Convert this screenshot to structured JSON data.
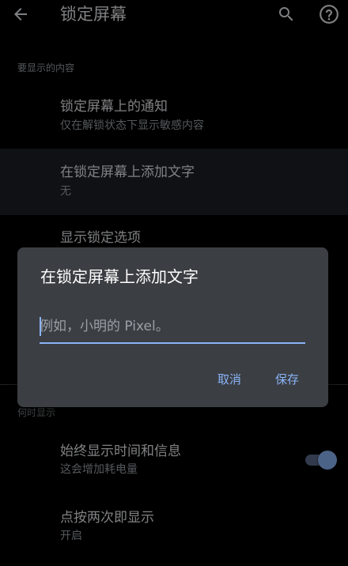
{
  "header": {
    "title": "锁定屏幕",
    "back_icon": "arrow-back-icon",
    "search_icon": "search-icon",
    "help_icon": "help-icon"
  },
  "sections": {
    "display_content": "要显示的内容",
    "when_to_show": "何时显示"
  },
  "prefs": {
    "notifications": {
      "title": "锁定屏幕上的通知",
      "summary": "仅在解锁状态下显示敏感内容"
    },
    "lock_text": {
      "title": "在锁定屏幕上添加文字",
      "summary": "无"
    },
    "lock_options": {
      "title": "显示锁定选项"
    },
    "always_on": {
      "title": "始终显示时间和信息",
      "summary": "这会增加耗电量",
      "enabled": true
    },
    "double_tap": {
      "title": "点按两次即显示",
      "summary": "开启"
    }
  },
  "dialog": {
    "title": "在锁定屏幕上添加文字",
    "input_value": "",
    "input_placeholder": "例如，小明的 Pixel。",
    "cancel_label": "取消",
    "save_label": "保存"
  },
  "colors": {
    "accent": "#8ab4f8",
    "background": "#000000",
    "dialog_bg": "#3b3e43",
    "highlight_row": "#1c1f25"
  }
}
